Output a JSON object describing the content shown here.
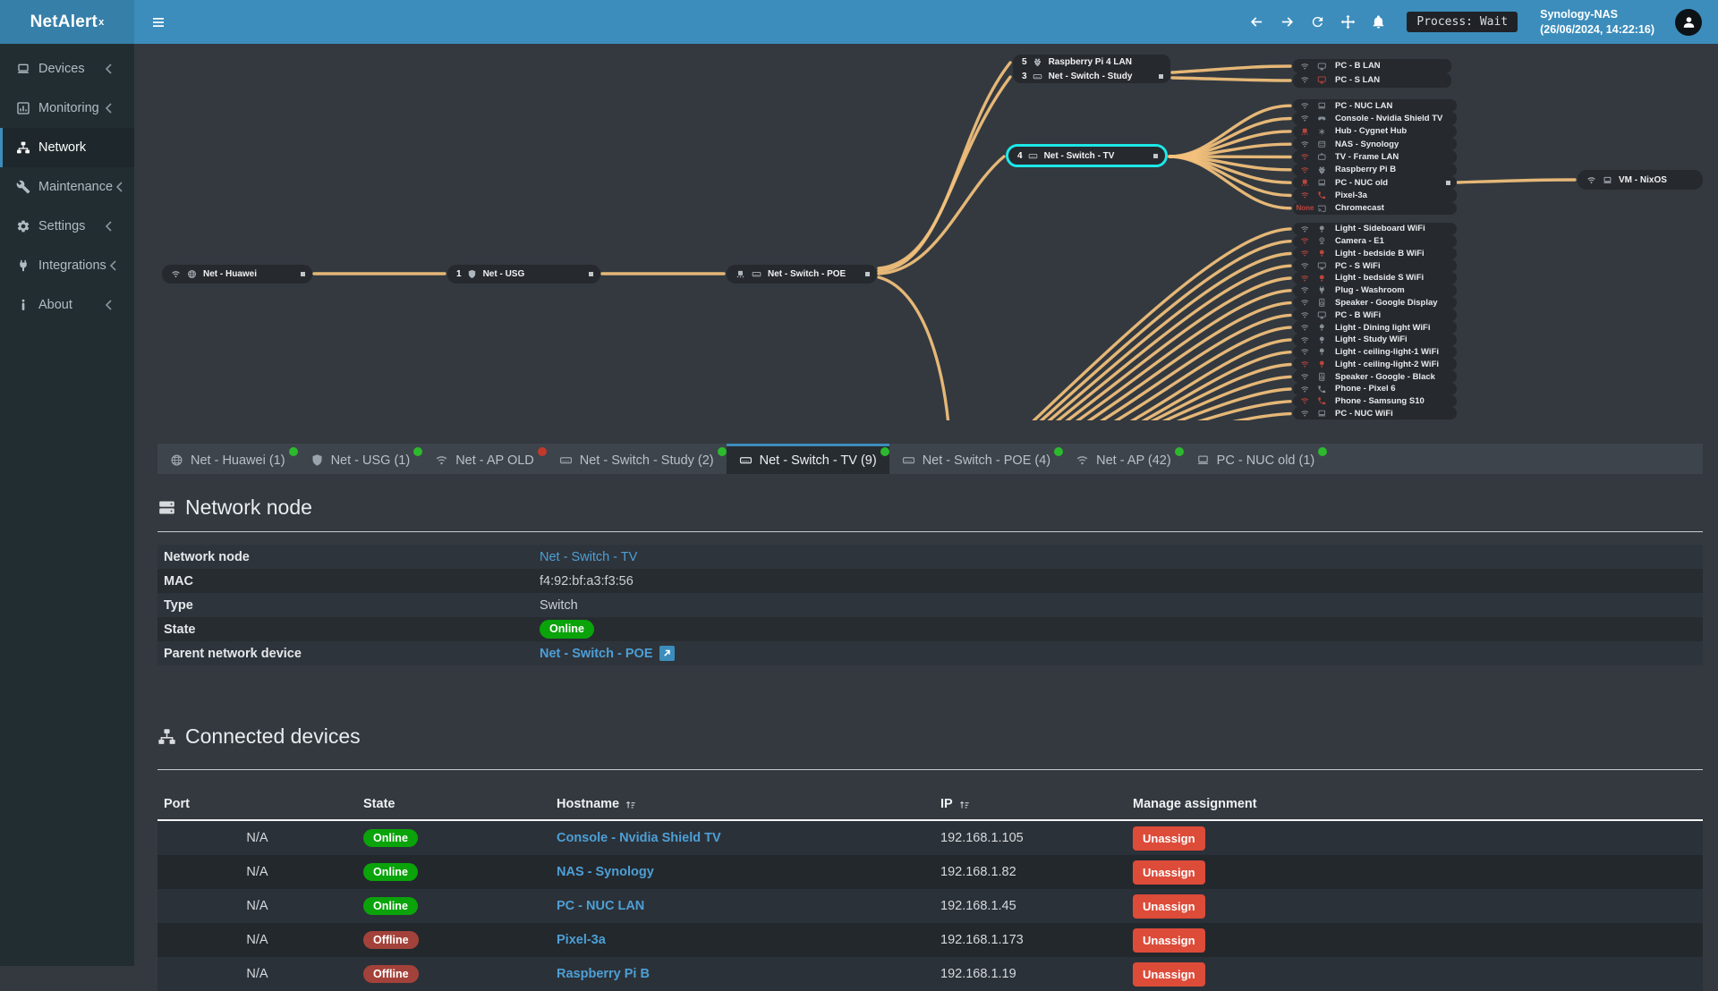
{
  "topbar": {
    "brand": "NetAlert",
    "brand_sup": "x",
    "process_label": "Process: Wait",
    "host_name": "Synology-NAS",
    "host_time": "(26/06/2024, 14:22:16)",
    "nav_icons": [
      "arrow-left",
      "arrow-right",
      "refresh",
      "move",
      "bell"
    ]
  },
  "sidebar": {
    "items": [
      {
        "label": "Devices",
        "icon": "laptop",
        "chevron": true,
        "active": false
      },
      {
        "label": "Monitoring",
        "icon": "chart",
        "chevron": true,
        "active": false
      },
      {
        "label": "Network",
        "icon": "sitemap",
        "chevron": false,
        "active": true
      },
      {
        "label": "Maintenance",
        "icon": "wrench",
        "chevron": true,
        "active": false
      },
      {
        "label": "Settings",
        "icon": "gear",
        "chevron": true,
        "active": false
      },
      {
        "label": "Integrations",
        "icon": "plug",
        "chevron": true,
        "active": false
      },
      {
        "label": "About",
        "icon": "info",
        "chevron": true,
        "active": false
      }
    ]
  },
  "diagram": {
    "hubs": {
      "huawei": {
        "icons": [
          "wifi",
          "globe"
        ],
        "label": "Net - Huawei",
        "square": true
      },
      "usg": {
        "count": "1",
        "icons": [
          "shield"
        ],
        "label": "Net - USG",
        "square": true
      },
      "poe": {
        "icons": [
          "eth",
          "switch"
        ],
        "label": "Net - Switch - POE",
        "square": true
      },
      "cluster": [
        {
          "count": "5",
          "icons": [
            "raspberry"
          ],
          "label": "Raspberry Pi 4 LAN",
          "square": false
        },
        {
          "count": "3",
          "icons": [
            "switch"
          ],
          "label": "Net - Switch - Study",
          "square": true
        }
      ],
      "tv": {
        "count": "4",
        "icons": [
          "switch"
        ],
        "label": "Net - Switch - TV",
        "square": true,
        "selected": true
      },
      "vm": {
        "icons": [
          "wifi",
          "laptop"
        ],
        "label": "VM - NixOS",
        "square": false
      }
    },
    "leaf_groups": {
      "top": [
        {
          "net": "wifi",
          "net_state": "on",
          "dev": "monitor",
          "dev_state": "on",
          "label": "PC - B LAN"
        },
        {
          "net": "wifi",
          "net_state": "on",
          "dev": "monitor",
          "dev_state": "off",
          "label": "PC - S LAN"
        }
      ],
      "middle": [
        {
          "net": "wifi",
          "net_state": "on",
          "dev": "laptop",
          "dev_state": "on",
          "label": "PC - NUC LAN"
        },
        {
          "net": "wifi",
          "net_state": "on",
          "dev": "console",
          "dev_state": "on",
          "label": "Console - Nvidia Shield TV"
        },
        {
          "net": "eth",
          "net_state": "off",
          "dev": "hub",
          "dev_state": "on",
          "label": "Hub - Cygnet Hub"
        },
        {
          "net": "wifi",
          "net_state": "on",
          "dev": "nas",
          "dev_state": "on",
          "label": "NAS - Synology"
        },
        {
          "net": "wifi",
          "net_state": "off",
          "dev": "tv",
          "dev_state": "on",
          "label": "TV - Frame LAN"
        },
        {
          "net": "wifi",
          "net_state": "off",
          "dev": "raspberry",
          "dev_state": "on",
          "label": "Raspberry Pi B"
        },
        {
          "net": "eth",
          "net_state": "off",
          "dev": "laptop",
          "dev_state": "on",
          "label": "PC - NUC old",
          "square": true
        },
        {
          "net": "wifi",
          "net_state": "off",
          "dev": "phone",
          "dev_state": "off",
          "label": "Pixel-3a"
        },
        {
          "net": "none",
          "net_text": "None",
          "dev": "cast",
          "dev_state": "on",
          "label": "Chromecast"
        }
      ],
      "bottom": [
        {
          "net": "wifi",
          "net_state": "on",
          "dev": "bulb",
          "dev_state": "on",
          "label": "Light - Sideboard WiFi"
        },
        {
          "net": "wifi",
          "net_state": "off",
          "dev": "camera",
          "dev_state": "on",
          "label": "Camera - E1"
        },
        {
          "net": "wifi",
          "net_state": "off",
          "dev": "bulb",
          "dev_state": "off",
          "label": "Light - bedside B WiFi"
        },
        {
          "net": "wifi",
          "net_state": "on",
          "dev": "monitor",
          "dev_state": "on",
          "label": "PC - S WiFi"
        },
        {
          "net": "wifi",
          "net_state": "off",
          "dev": "bulb",
          "dev_state": "off",
          "label": "Light - bedside S WiFi"
        },
        {
          "net": "wifi",
          "net_state": "on",
          "dev": "plug",
          "dev_state": "on",
          "label": "Plug - Washroom"
        },
        {
          "net": "wifi",
          "net_state": "on",
          "dev": "speaker",
          "dev_state": "on",
          "label": "Speaker - Google Display"
        },
        {
          "net": "wifi",
          "net_state": "on",
          "dev": "monitor",
          "dev_state": "on",
          "label": "PC - B WiFi"
        },
        {
          "net": "wifi",
          "net_state": "on",
          "dev": "bulb",
          "dev_state": "on",
          "label": "Light - Dining light WiFi"
        },
        {
          "net": "wifi",
          "net_state": "on",
          "dev": "bulb",
          "dev_state": "on",
          "label": "Light - Study WiFi"
        },
        {
          "net": "wifi",
          "net_state": "on",
          "dev": "bulb",
          "dev_state": "on",
          "label": "Light - ceiling-light-1 WiFi"
        },
        {
          "net": "wifi",
          "net_state": "off",
          "dev": "bulb",
          "dev_state": "off",
          "label": "Light - ceiling-light-2 WiFi"
        },
        {
          "net": "wifi",
          "net_state": "on",
          "dev": "speaker",
          "dev_state": "on",
          "label": "Speaker - Google - Black"
        },
        {
          "net": "wifi",
          "net_state": "on",
          "dev": "phone",
          "dev_state": "on",
          "label": "Phone - Pixel 6"
        },
        {
          "net": "wifi",
          "net_state": "off",
          "dev": "phone",
          "dev_state": "off",
          "label": "Phone - Samsung S10"
        },
        {
          "net": "wifi",
          "net_state": "on",
          "dev": "laptop",
          "dev_state": "on",
          "label": "PC - NUC WiFi"
        }
      ]
    }
  },
  "tabs": [
    {
      "label": "Net - Huawei (1)",
      "icon": "globe",
      "dot": "green",
      "active": false
    },
    {
      "label": "Net - USG (1)",
      "icon": "shield",
      "dot": "green",
      "active": false
    },
    {
      "label": "Net - AP OLD",
      "icon": "wifi",
      "dot": "red",
      "active": false
    },
    {
      "label": "Net - Switch - Study (2)",
      "icon": "switch",
      "dot": "green",
      "active": false
    },
    {
      "label": "Net - Switch - TV (9)",
      "icon": "switch",
      "dot": "green",
      "active": true
    },
    {
      "label": "Net - Switch - POE (4)",
      "icon": "switch",
      "dot": "green",
      "active": false
    },
    {
      "label": "Net - AP (42)",
      "icon": "wifi",
      "dot": "green",
      "active": false
    },
    {
      "label": "PC - NUC old (1)",
      "icon": "laptop",
      "dot": "green",
      "active": false
    }
  ],
  "network_node": {
    "title": "Network node",
    "rows": [
      {
        "label": "Network node",
        "value": "Net - Switch - TV",
        "kind": "link"
      },
      {
        "label": "MAC",
        "value": "f4:92:bf:a3:f3:56",
        "kind": "text"
      },
      {
        "label": "Type",
        "value": "Switch",
        "kind": "text"
      },
      {
        "label": "State",
        "value": "Online",
        "kind": "badge"
      },
      {
        "label": "Parent network device",
        "value": "Net - Switch - POE",
        "kind": "link-ext"
      }
    ]
  },
  "connected_devices": {
    "title": "Connected devices",
    "headers": [
      {
        "label": "Port",
        "sort": false
      },
      {
        "label": "State",
        "sort": false
      },
      {
        "label": "Hostname",
        "sort": true
      },
      {
        "label": "IP",
        "sort": true
      },
      {
        "label": "Manage assignment",
        "sort": false
      }
    ],
    "unassign_label": "Unassign",
    "rows": [
      {
        "port": "N/A",
        "state": "Online",
        "hostname": "Console - Nvidia Shield TV",
        "ip": "192.168.1.105"
      },
      {
        "port": "N/A",
        "state": "Online",
        "hostname": "NAS - Synology",
        "ip": "192.168.1.82"
      },
      {
        "port": "N/A",
        "state": "Online",
        "hostname": "PC - NUC LAN",
        "ip": "192.168.1.45"
      },
      {
        "port": "N/A",
        "state": "Offline",
        "hostname": "Pixel-3a",
        "ip": "192.168.1.173"
      },
      {
        "port": "N/A",
        "state": "Offline",
        "hostname": "Raspberry Pi B",
        "ip": "192.168.1.19"
      }
    ]
  },
  "colors": {
    "topbar": "#3c8dbc",
    "brand_bg": "#367fa9",
    "sidebar": "#222d32",
    "content": "#33393f",
    "edge": "#f3c17c",
    "highlight": "#1ce8e8",
    "link": "#4d9fd6",
    "online": "#0aa30a",
    "offline": "#a3423a",
    "unassign": "#dd4b39",
    "node_bg": "#26292e",
    "dot_green": "#2db92d",
    "dot_red": "#c0392b"
  }
}
